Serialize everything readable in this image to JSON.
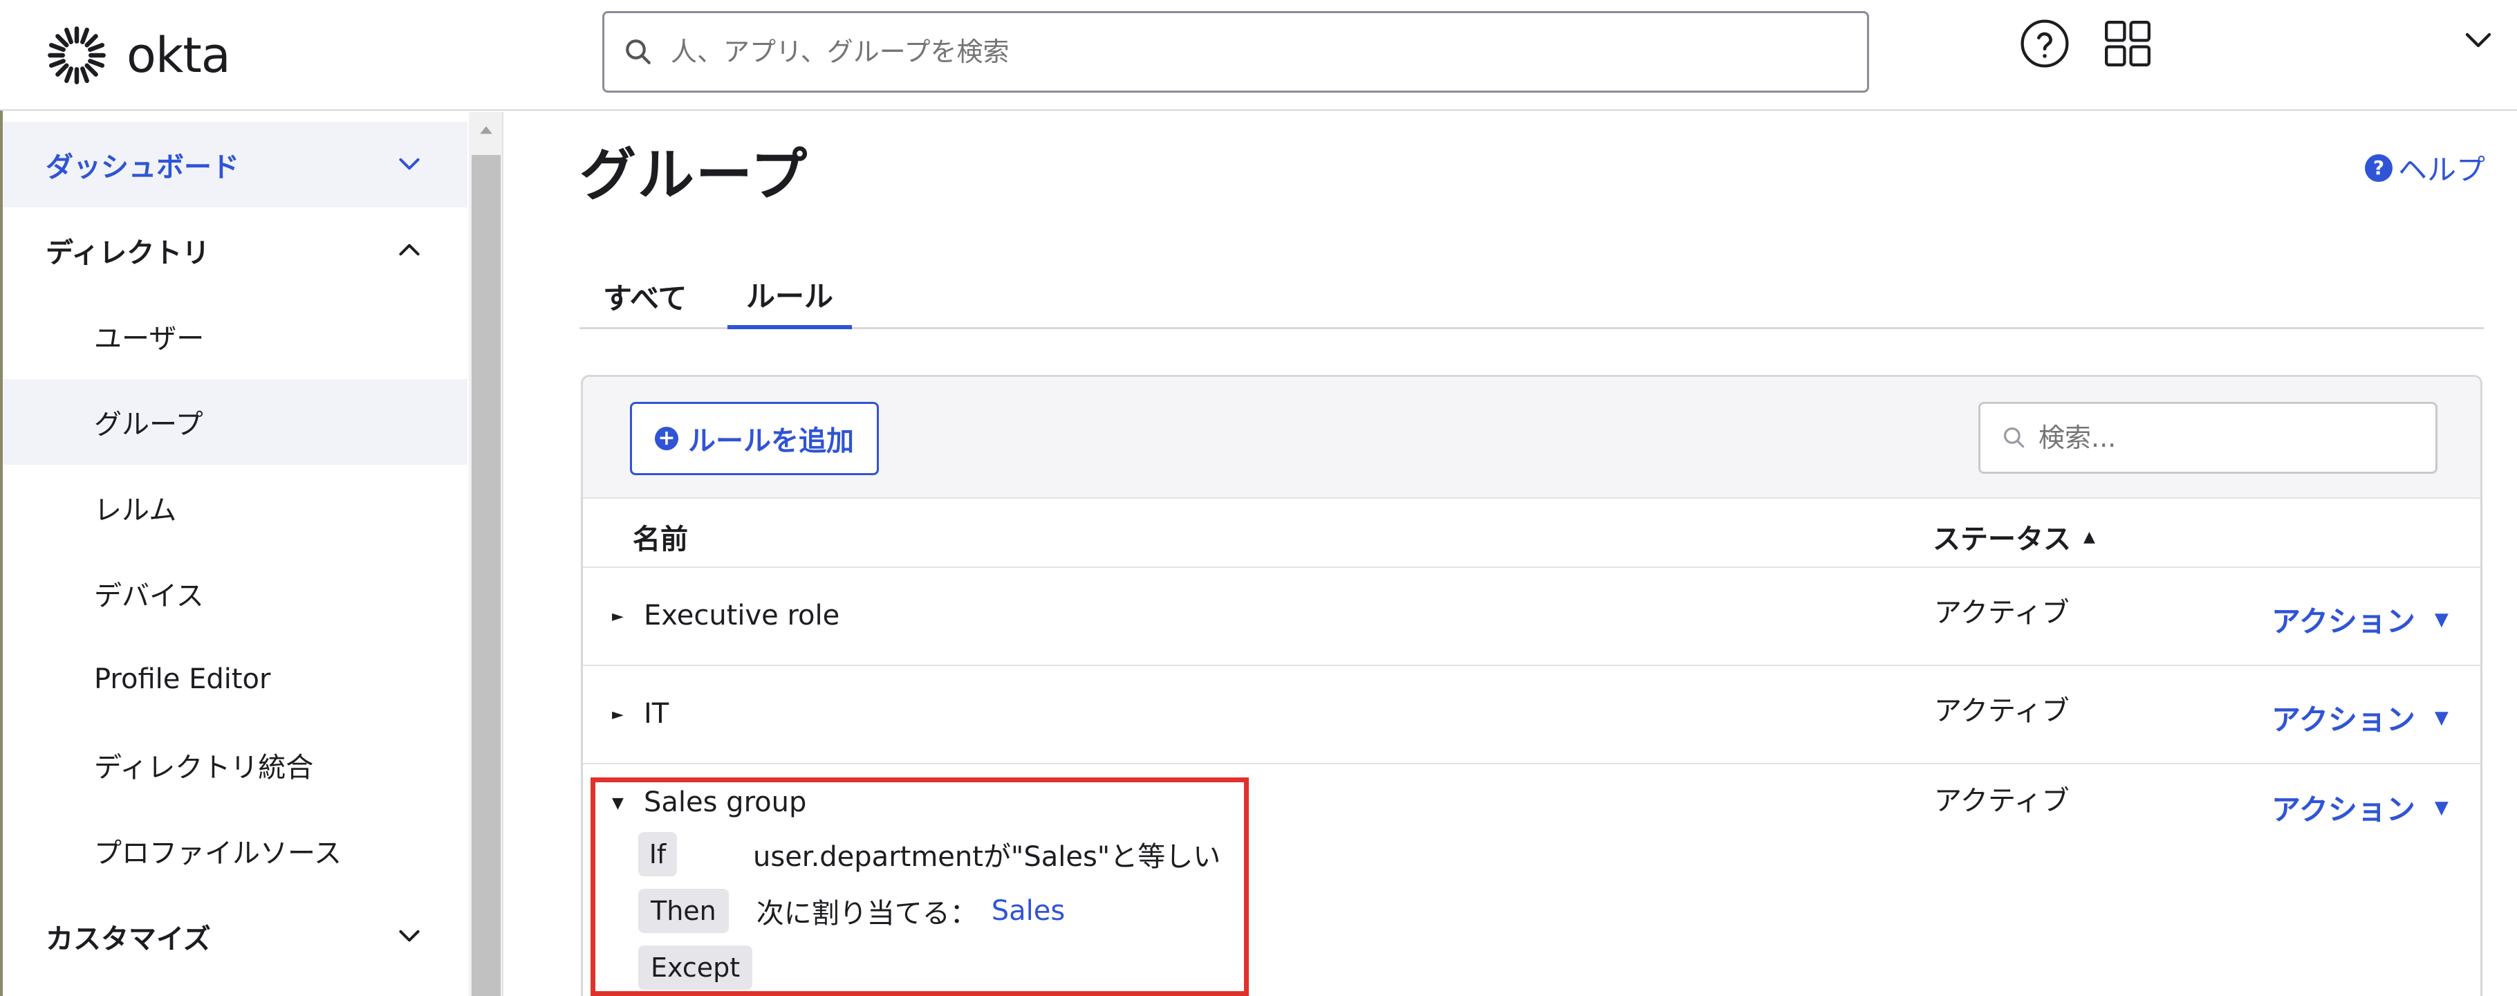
{
  "header": {
    "logo_text": "okta",
    "search_placeholder": "人、アプリ、グループを検索"
  },
  "sidebar": {
    "items": [
      {
        "label": "ダッシュボード",
        "level": "top",
        "expanded": false,
        "active": true
      },
      {
        "label": "ディレクトリ",
        "level": "top",
        "expanded": true
      },
      {
        "label": "ユーザー",
        "level": "sub"
      },
      {
        "label": "グループ",
        "level": "sub",
        "selected": true
      },
      {
        "label": "レルム",
        "level": "sub"
      },
      {
        "label": "デバイス",
        "level": "sub"
      },
      {
        "label": "Profile Editor",
        "level": "sub"
      },
      {
        "label": "ディレクトリ統合",
        "level": "sub"
      },
      {
        "label": "プロファイルソース",
        "level": "sub"
      },
      {
        "label": "カスタマイズ",
        "level": "top",
        "expanded": false
      }
    ]
  },
  "main": {
    "title": "グループ",
    "help_label": "ヘルプ",
    "tabs": [
      {
        "label": "すべて",
        "active": false
      },
      {
        "label": "ルール",
        "active": true
      }
    ],
    "add_rule_label": "ルールを追加",
    "rule_search_placeholder": "検索...",
    "table": {
      "columns": {
        "name": "名前",
        "status": "ステータス"
      },
      "rows": [
        {
          "name": "Executive role",
          "status": "アクティブ",
          "action": "アクション"
        },
        {
          "name": "IT",
          "status": "アクティブ",
          "action": "アクション"
        },
        {
          "name": "Sales group",
          "status": "アクティブ",
          "action": "アクション",
          "expanded": true,
          "if_label": "If",
          "if_text": "user.departmentが\"Sales\"と等しい",
          "then_label": "Then",
          "then_text": "次に割り当てる：",
          "then_link": "Sales",
          "except_label": "Except"
        }
      ]
    }
  },
  "colors": {
    "accent": "#2f54d6",
    "highlight": "#e0312b"
  }
}
